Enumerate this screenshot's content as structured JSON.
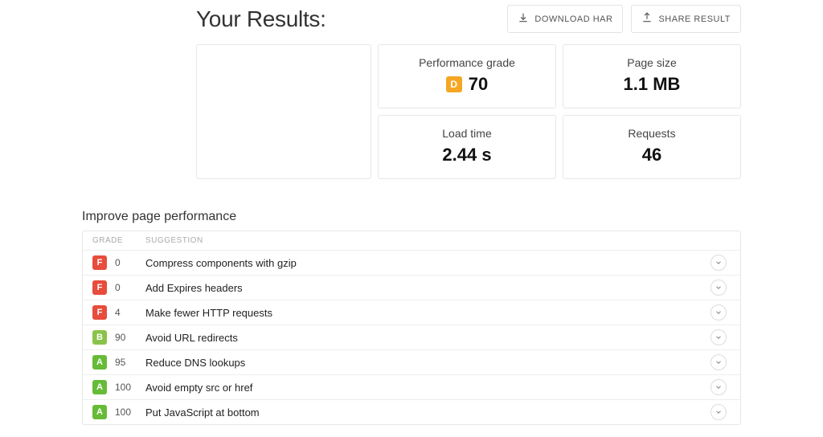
{
  "header": {
    "title": "Your Results:",
    "download_label": "DOWNLOAD HAR",
    "share_label": "SHARE RESULT"
  },
  "metrics": {
    "performance_grade": {
      "label": "Performance grade",
      "letter": "D",
      "value": "70"
    },
    "page_size": {
      "label": "Page size",
      "value": "1.1 MB"
    },
    "load_time": {
      "label": "Load time",
      "value": "2.44 s"
    },
    "requests": {
      "label": "Requests",
      "value": "46"
    }
  },
  "improve": {
    "section_title": "Improve page performance",
    "col_grade": "GRADE",
    "col_suggestion": "SUGGESTION",
    "rows": [
      {
        "letter": "F",
        "score": "0",
        "text": "Compress components with gzip"
      },
      {
        "letter": "F",
        "score": "0",
        "text": "Add Expires headers"
      },
      {
        "letter": "F",
        "score": "4",
        "text": "Make fewer HTTP requests"
      },
      {
        "letter": "B",
        "score": "90",
        "text": "Avoid URL redirects"
      },
      {
        "letter": "A",
        "score": "95",
        "text": "Reduce DNS lookups"
      },
      {
        "letter": "A",
        "score": "100",
        "text": "Avoid empty src or href"
      },
      {
        "letter": "A",
        "score": "100",
        "text": "Put JavaScript at bottom"
      }
    ]
  },
  "colors": {
    "A": "#66bb37",
    "B": "#8bc34a",
    "D": "#f5a623",
    "F": "#e74c3c"
  }
}
